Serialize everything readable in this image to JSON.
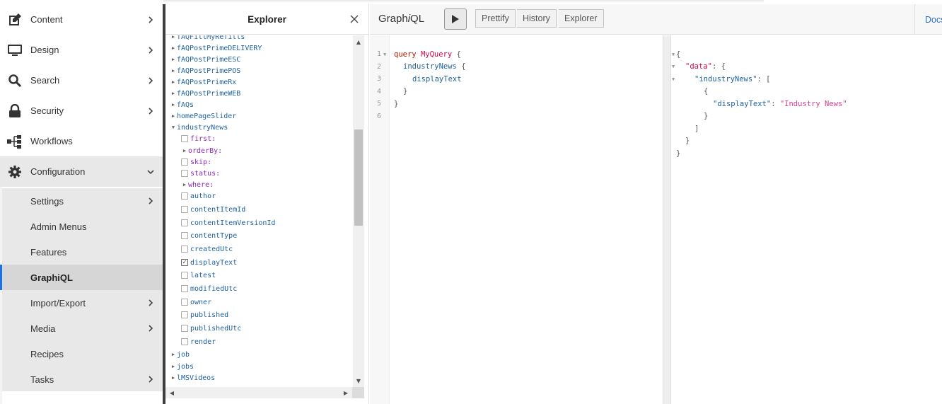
{
  "sidebar": {
    "items": [
      {
        "label": "Content",
        "icon": "edit-icon"
      },
      {
        "label": "Design",
        "icon": "monitor-icon"
      },
      {
        "label": "Search",
        "icon": "search-icon"
      },
      {
        "label": "Security",
        "icon": "lock-icon"
      },
      {
        "label": "Workflows",
        "icon": "workflow-icon"
      },
      {
        "label": "Configuration",
        "icon": "gear-icon"
      }
    ],
    "sub_items": [
      {
        "label": "Settings"
      },
      {
        "label": "Admin Menus"
      },
      {
        "label": "Features"
      },
      {
        "label": "GraphiQL"
      },
      {
        "label": "Import/Export"
      },
      {
        "label": "Media"
      },
      {
        "label": "Recipes"
      },
      {
        "label": "Tasks"
      }
    ]
  },
  "explorer": {
    "title": "Explorer",
    "rows": [
      {
        "text": "fAQFillMyRefills",
        "kind": "field",
        "tri": "right"
      },
      {
        "text": "fAQPostPrimeDELIVERY",
        "kind": "field",
        "tri": "right"
      },
      {
        "text": "fAQPostPrimeESC",
        "kind": "field",
        "tri": "right"
      },
      {
        "text": "fAQPostPrimePOS",
        "kind": "field",
        "tri": "right"
      },
      {
        "text": "fAQPostPrimeRx",
        "kind": "field",
        "tri": "right"
      },
      {
        "text": "fAQPostPrimeWEB",
        "kind": "field",
        "tri": "right"
      },
      {
        "text": "fAQs",
        "kind": "field",
        "tri": "right"
      },
      {
        "text": "homePageSlider",
        "kind": "field",
        "tri": "right"
      },
      {
        "text": "industryNews",
        "kind": "field",
        "tri": "down"
      },
      {
        "text": "first:",
        "kind": "arg",
        "cb": false
      },
      {
        "text": "orderBy:",
        "kind": "arg",
        "tri": "right"
      },
      {
        "text": "skip:",
        "kind": "arg",
        "cb": false
      },
      {
        "text": "status:",
        "kind": "arg",
        "cb": false
      },
      {
        "text": "where:",
        "kind": "arg",
        "tri": "right"
      },
      {
        "text": "author",
        "kind": "sub",
        "cb": false
      },
      {
        "text": "contentItemId",
        "kind": "sub",
        "cb": false
      },
      {
        "text": "contentItemVersionId",
        "kind": "sub",
        "cb": false
      },
      {
        "text": "contentType",
        "kind": "sub",
        "cb": false
      },
      {
        "text": "createdUtc",
        "kind": "sub",
        "cb": false
      },
      {
        "text": "displayText",
        "kind": "sub",
        "cb": true
      },
      {
        "text": "latest",
        "kind": "sub",
        "cb": false
      },
      {
        "text": "modifiedUtc",
        "kind": "sub",
        "cb": false
      },
      {
        "text": "owner",
        "kind": "sub",
        "cb": false
      },
      {
        "text": "published",
        "kind": "sub",
        "cb": false
      },
      {
        "text": "publishedUtc",
        "kind": "sub",
        "cb": false
      },
      {
        "text": "render",
        "kind": "sub",
        "cb": false
      },
      {
        "text": "job",
        "kind": "field",
        "tri": "right"
      },
      {
        "text": "jobs",
        "kind": "field",
        "tri": "right"
      },
      {
        "text": "lMSVideos",
        "kind": "field",
        "tri": "right"
      }
    ]
  },
  "toolbar": {
    "title_pre": "Graph",
    "title_i": "i",
    "title_post": "QL",
    "prettify": "Prettify",
    "history": "History",
    "explorer": "Explorer",
    "docs": "Docs"
  },
  "editor": {
    "line_numbers": [
      "1",
      "2",
      "3",
      "4",
      "5",
      "6"
    ],
    "l1_kw": "query",
    "l1_name": "MyQuery",
    "l1_brace": "{",
    "l2_field": "industryNews",
    "l2_brace": "{",
    "l3_field": "displayText",
    "l4": "}",
    "l5": "}"
  },
  "result": {
    "open": "{",
    "data_key": "\"data\"",
    "colon_brace": ": {",
    "news_key": "\"industryNews\"",
    "colon_bracket": ": [",
    "obj_open": "{",
    "display_key": "\"displayText\"",
    "colon": ": ",
    "display_val": "\"Industry News\"",
    "obj_close": "}",
    "arr_close": "]",
    "data_close": "}",
    "close": "}"
  }
}
